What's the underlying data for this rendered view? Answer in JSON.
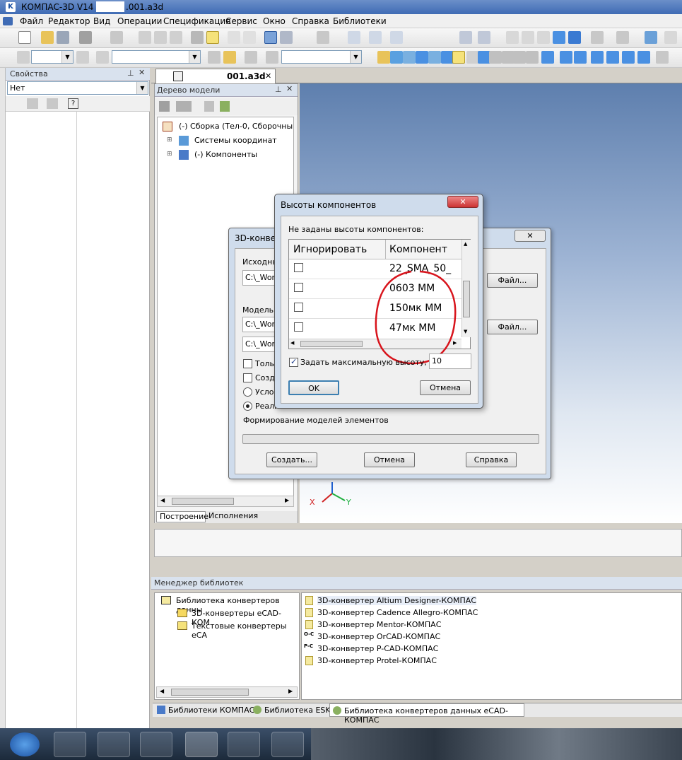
{
  "window": {
    "title": "КОМПАС-3D V14 - ",
    "doc_suffix": ".001.a3d"
  },
  "menu": [
    "Файл",
    "Редактор",
    "Вид",
    "Операции",
    "Спецификация",
    "Сервис",
    "Окно",
    "Справка",
    "Библиотеки"
  ],
  "properties_panel": {
    "title": "Свойства",
    "select_value": "Нет"
  },
  "doc_tab": {
    "label": "001.a3d"
  },
  "model_tree": {
    "title": "Дерево модели",
    "items": [
      "(-) Сборка (Тел-0, Сборочны",
      "Системы координат",
      "(-) Компоненты"
    ],
    "tabs": [
      "Построение",
      "Исполнения"
    ]
  },
  "converter_dialog": {
    "title": "3D-конвер",
    "source_label": "Исходны",
    "source_path": "C:\\_Wor",
    "model_label": "Модель п",
    "model_path1": "C:\\_Wor",
    "model_path2": "C:\\_Wor",
    "file_button": "Файл...",
    "check1": "Тольк",
    "check2": "Созда",
    "radio1": "Услов",
    "radio2": "Реали",
    "progress_label": "Формирование моделей элементов",
    "create_button": "Создать...",
    "cancel_button": "Отмена",
    "help_button": "Справка"
  },
  "heights_dialog": {
    "title": "Высоты компонентов",
    "info": "Не заданы высоты компонентов:",
    "columns": [
      "Игнорировать",
      "Компонент"
    ],
    "rows": [
      "22_SMA_50_",
      "0603 MM",
      "150мк MM",
      "47мк MM"
    ],
    "max_height_label": "Задать максимальную высоту, мм:",
    "max_height_value": "10",
    "ok": "OK",
    "cancel": "Отмена"
  },
  "axes": {
    "x": "X",
    "y": "Y"
  },
  "library_manager": {
    "title": "Менеджер библиотек",
    "tree": [
      "Библиотека конвертеров данны",
      "3D-конвертеры eCAD-КОМ",
      "Текстовые конвертеры eCA"
    ],
    "items": [
      "3D-конвертер Altium Designer-КОМПАС",
      "3D-конвертер Cadence Allegro-КОМПАС",
      "3D-конвертер Mentor-КОМПАС",
      "3D-конвертер OrCAD-КОМПАС",
      "3D-конвертер P-CAD-КОМПАС",
      "3D-конвертер Protel-КОМПАС"
    ],
    "tabs": [
      "Библиотеки КОМПАС",
      "Библиотека ESK",
      "Библиотека конвертеров данных eCAD-КОМПАС"
    ]
  },
  "colors": {
    "annotation_circle": "#d8141c",
    "titlebar": "#3f6bb5"
  }
}
